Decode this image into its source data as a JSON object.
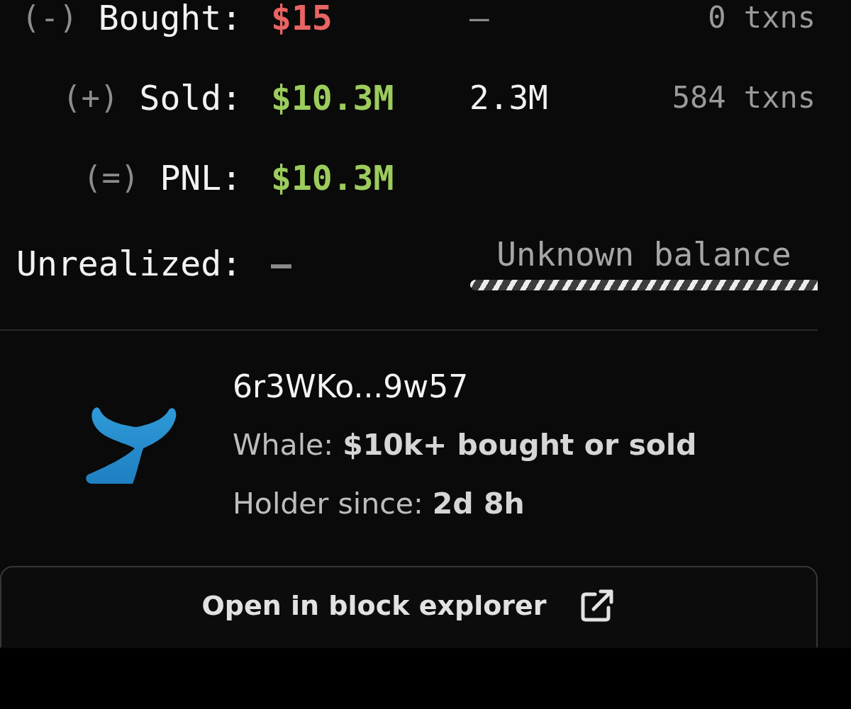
{
  "rows": [
    {
      "sign": "(-)",
      "label": "Bought:",
      "value": "$15",
      "color": "#e86464",
      "amount": "—",
      "amount_muted": true,
      "txns": "0 txns"
    },
    {
      "sign": "(+)",
      "label": "Sold:",
      "value": "$10.3M",
      "color": "#9ccc5c",
      "amount": "2.3M",
      "amount_muted": false,
      "txns": "584 txns"
    },
    {
      "sign": "(=)",
      "label": "PNL:",
      "value": "$10.3M",
      "color": "#9ccc5c"
    }
  ],
  "unrealized": {
    "label": "Unrealized:",
    "value": "—",
    "balance": "Unknown balance"
  },
  "holder": {
    "kind": "whale",
    "address": "6r3WKo...9w57",
    "tag": "Whale: **$10k+ bought or sold**",
    "since": "Holder since: **2d 8h**"
  },
  "button": {
    "label": "Open in block explorer"
  }
}
